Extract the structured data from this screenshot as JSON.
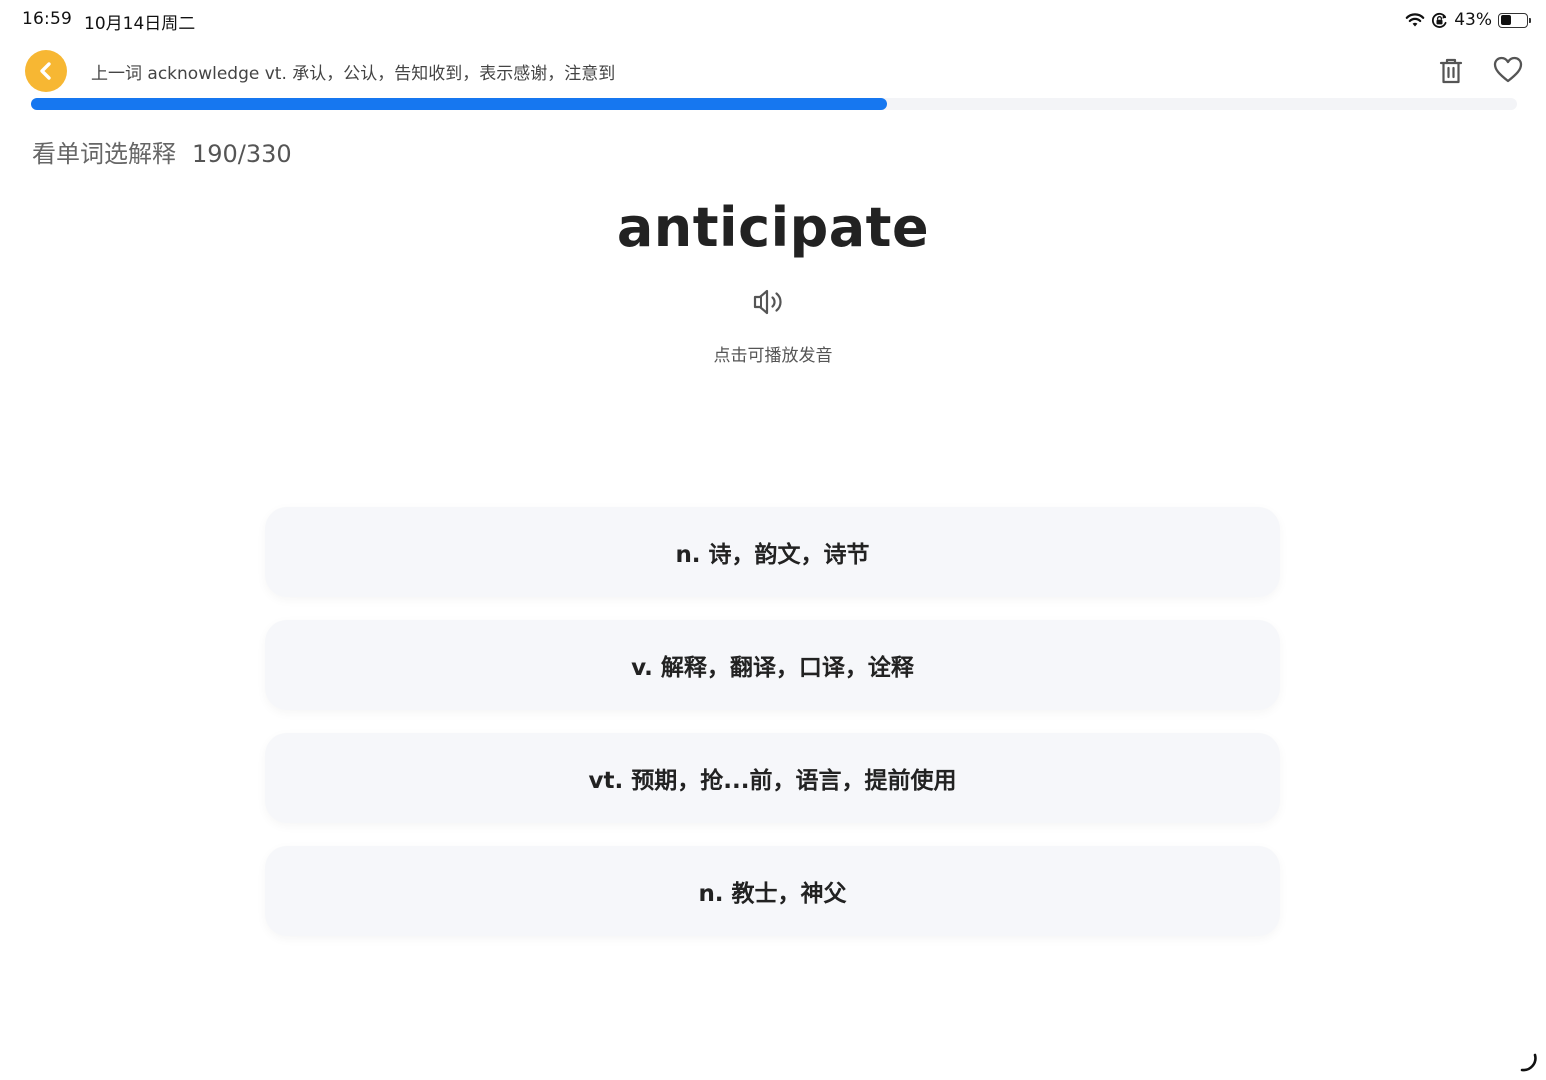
{
  "status_bar": {
    "time": "16:59",
    "date": "10月14日周二",
    "battery_text": "43%",
    "battery_level": 0.43,
    "icons": [
      "wifi-icon",
      "orientation-lock-icon",
      "battery-icon"
    ]
  },
  "header": {
    "back_icon": "chevron-left-icon",
    "back_color": "#f7b733",
    "prev_word_text": "上一词 acknowledge vt. 承认，公认，告知收到，表示感谢，注意到",
    "trash_icon": "trash-icon",
    "heart_icon": "heart-icon"
  },
  "progress": {
    "current": 190,
    "total": 330,
    "fraction": 0.576,
    "color": "#1677f0"
  },
  "mode": {
    "label": "看单词选解释",
    "count_text": "190/330"
  },
  "word": {
    "text": "anticipate",
    "speaker_icon": "speaker-icon",
    "speaker_hint": "点击可播放发音"
  },
  "options": [
    {
      "label": "n. 诗，韵文，诗节"
    },
    {
      "label": "v. 解释，翻译，口译，诠释"
    },
    {
      "label": "vt. 预期，抢...前，语言，提前使用"
    },
    {
      "label": "n. 教士，神父"
    }
  ]
}
